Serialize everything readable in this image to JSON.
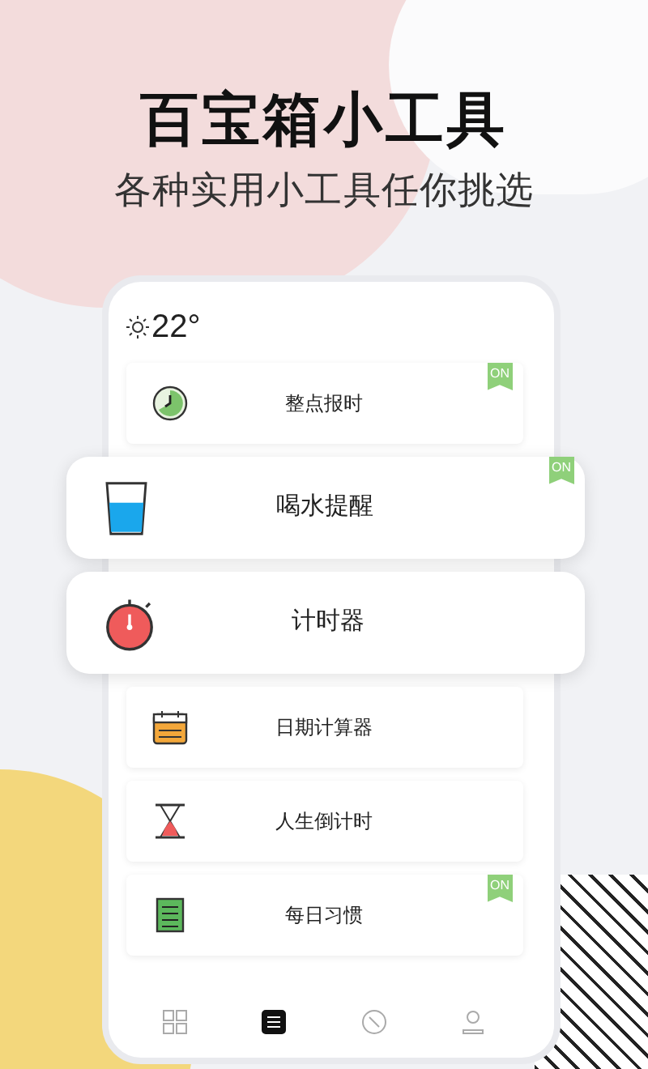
{
  "title": "百宝箱小工具",
  "subtitle": "各种实用小工具任你挑选",
  "weather": {
    "temperature": "22°"
  },
  "tools": [
    {
      "label": "整点报时",
      "highlighted": false,
      "badge": "ON"
    },
    {
      "label": "喝水提醒",
      "highlighted": true,
      "badge": "ON"
    },
    {
      "label": "计时器",
      "highlighted": true
    },
    {
      "label": "日期计算器",
      "highlighted": false
    },
    {
      "label": "人生倒计时",
      "highlighted": false
    },
    {
      "label": "每日习惯",
      "highlighted": false,
      "badge": "ON"
    }
  ],
  "nav": [
    {
      "selected": false
    },
    {
      "selected": true
    },
    {
      "selected": false
    },
    {
      "selected": false
    }
  ]
}
